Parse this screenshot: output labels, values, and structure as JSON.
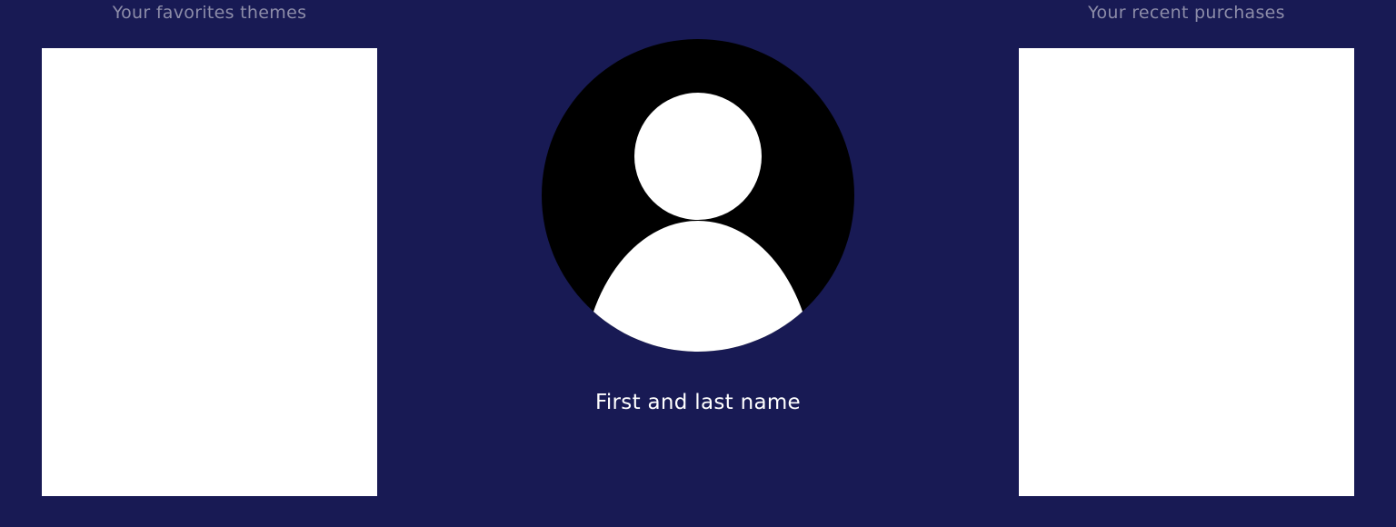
{
  "favorites": {
    "title": "Your favorites themes"
  },
  "profile": {
    "name": "First and last name",
    "avatar_icon": "user-silhouette-icon"
  },
  "purchases": {
    "title": "Your recent purchases"
  },
  "colors": {
    "background": "#181a54",
    "panel": "#ffffff",
    "heading_text": "#8c8ca8",
    "name_text": "#ffffff",
    "avatar_bg": "#000000"
  }
}
